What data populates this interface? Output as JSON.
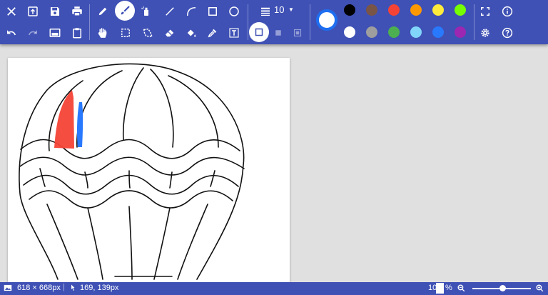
{
  "toolbar": {
    "brush_size": "10",
    "primary_color": "#ffffff",
    "accent": "#3f51b5",
    "active_tool": "brush",
    "row1_icons": [
      "close-icon",
      "upload-icon",
      "save-icon",
      "print-icon",
      "pencil-icon",
      "brush-icon",
      "spray-icon",
      "line-icon",
      "curve-icon",
      "rectangle-icon",
      "ellipse-icon",
      "fullscreen-icon",
      "info-icon"
    ],
    "row2_icons": [
      "undo-icon",
      "redo-icon",
      "image-icon",
      "clipboard-icon",
      "hand-icon",
      "select-rect-icon",
      "select-lasso-icon",
      "eraser-icon",
      "fill-icon",
      "eyedropper-icon",
      "text-icon",
      "shape-outline-icon",
      "shape-filled-icon",
      "shape-both-icon",
      "settings-icon",
      "help-icon"
    ]
  },
  "palette": {
    "row1": [
      "#000000",
      "#795548",
      "#f44336",
      "#ff9800",
      "#ffeb3b",
      "#76ff03"
    ],
    "row2": [
      "#ffffff",
      "#9e9e9e",
      "#4caf50",
      "#81d4fa",
      "#2979ff",
      "#9c27b0"
    ]
  },
  "status": {
    "image_size": "618 × 668px",
    "cursor_pos": "169, 139px",
    "zoom_prefix": "10",
    "zoom_suffix": "%"
  },
  "canvas": {
    "background": "#ffffff",
    "paint_colors": [
      "#f44336",
      "#2979ff"
    ]
  }
}
